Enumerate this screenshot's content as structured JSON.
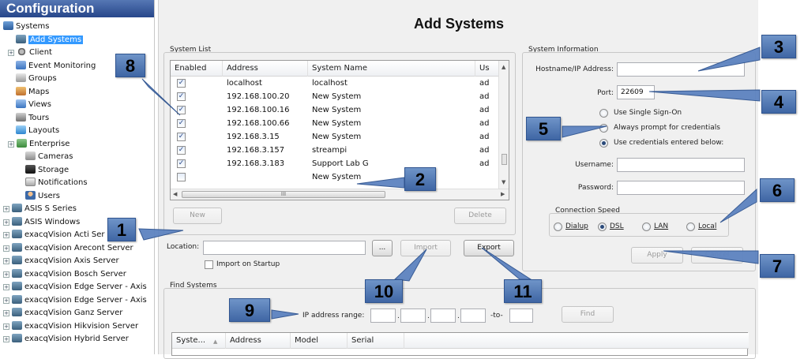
{
  "tree": {
    "header": "Configuration",
    "items": [
      {
        "label": "Systems",
        "icon": "systems-icon",
        "expander": false
      },
      {
        "label": "Add Systems",
        "icon": "server-icon",
        "expander": false,
        "selected": true
      },
      {
        "label": "Client",
        "icon": "gear-icon",
        "expander": true
      },
      {
        "label": "Event Monitoring",
        "icon": "event-icon",
        "expander": false
      },
      {
        "label": "Groups",
        "icon": "groups-icon",
        "expander": false
      },
      {
        "label": "Maps",
        "icon": "maps-icon",
        "expander": false
      },
      {
        "label": "Views",
        "icon": "views-icon",
        "expander": false
      },
      {
        "label": "Tours",
        "icon": "tours-icon",
        "expander": false
      },
      {
        "label": "Layouts",
        "icon": "layouts-icon",
        "expander": false
      },
      {
        "label": "Enterprise",
        "icon": "enterprise-icon",
        "expander": true
      },
      {
        "label": "Cameras",
        "icon": "camera-icon",
        "expander": false
      },
      {
        "label": "Storage",
        "icon": "storage-icon",
        "expander": false
      },
      {
        "label": "Notifications",
        "icon": "notifications-icon",
        "expander": false
      },
      {
        "label": "Users",
        "icon": "users-icon",
        "expander": false
      },
      {
        "label": "ASIS S Series",
        "icon": "server-icon",
        "expander": true
      },
      {
        "label": "ASIS Windows",
        "icon": "server-icon",
        "expander": true
      },
      {
        "label": "exacqVision Acti Ser",
        "icon": "server-icon",
        "expander": true
      },
      {
        "label": "exacqVision Arecont Server",
        "icon": "server-icon",
        "expander": true
      },
      {
        "label": "exacqVision Axis Server",
        "icon": "server-icon",
        "expander": true
      },
      {
        "label": "exacqVision Bosch Server",
        "icon": "server-icon",
        "expander": true
      },
      {
        "label": "exacqVision Edge Server - Axis",
        "icon": "server-icon",
        "expander": true
      },
      {
        "label": "exacqVision Edge Server - Axis",
        "icon": "server-icon",
        "expander": true
      },
      {
        "label": "exacqVision Ganz Server",
        "icon": "server-icon",
        "expander": true
      },
      {
        "label": "exacqVision Hikvision Server",
        "icon": "server-icon",
        "expander": true
      },
      {
        "label": "exacqVision Hybrid Server",
        "icon": "server-icon",
        "expander": true
      }
    ]
  },
  "main": {
    "title": "Add Systems",
    "system_list": {
      "label": "System List",
      "columns": [
        "Enabled",
        "Address",
        "System Name",
        "Us"
      ],
      "rows": [
        {
          "enabled": true,
          "address": "localhost",
          "name": "localhost",
          "user": "ad"
        },
        {
          "enabled": true,
          "address": "192.168.100.20",
          "name": "New System",
          "user": "ad"
        },
        {
          "enabled": true,
          "address": "192.168.100.16",
          "name": "New System",
          "user": "ad"
        },
        {
          "enabled": true,
          "address": "192.168.100.66",
          "name": "New System",
          "user": "ad"
        },
        {
          "enabled": true,
          "address": "192.168.3.15",
          "name": "New System",
          "user": "ad"
        },
        {
          "enabled": true,
          "address": "192.168.3.157",
          "name": "streampi",
          "user": "ad"
        },
        {
          "enabled": true,
          "address": "192.168.3.183",
          "name": "Support Lab G",
          "user": "ad"
        },
        {
          "enabled": false,
          "address": "",
          "name": "New System",
          "user": ""
        }
      ],
      "hscroll_thumb": "III",
      "new_button": "New",
      "delete_button": "Delete"
    },
    "location": {
      "label": "Location:",
      "value": "",
      "browse_button": "...",
      "import_button": "Import",
      "export_button": "Export",
      "import_on_startup": "Import on Startup"
    },
    "system_info": {
      "label": "System Information",
      "hostname_label": "Hostname/IP Address:",
      "hostname_value": "",
      "port_label": "Port:",
      "port_value": "22609",
      "sso_options": [
        {
          "label": "Use Single Sign-On",
          "checked": false
        },
        {
          "label": "Always prompt for credentials",
          "checked": false
        },
        {
          "label": "Use credentials entered below:",
          "checked": true
        }
      ],
      "username_label": "Username:",
      "username_value": "",
      "password_label": "Password:",
      "password_value": "",
      "connection_speed": {
        "label": "Connection Speed",
        "options": [
          {
            "label": "Dialup",
            "checked": false
          },
          {
            "label": "DSL",
            "checked": true
          },
          {
            "label": "LAN",
            "checked": false
          },
          {
            "label": "Local",
            "checked": false
          }
        ]
      },
      "apply_button": "Apply",
      "cancel_button": "Cancel"
    },
    "find_systems": {
      "label": "Find Systems",
      "ip_range_label": "IP address range:",
      "to_label": "-to-",
      "find_button": "Find",
      "columns": [
        "Syste...",
        "Address",
        "Model",
        "Serial"
      ]
    }
  },
  "callouts": [
    "1",
    "2",
    "3",
    "4",
    "5",
    "6",
    "7",
    "8",
    "9",
    "10",
    "11"
  ],
  "colors": {
    "header_gradient_top": "#5577b4",
    "header_gradient_bottom": "#27468a",
    "selection": "#3399ff",
    "callout_fill": "#4f76b4",
    "pane_background": "#f0f0f0"
  }
}
